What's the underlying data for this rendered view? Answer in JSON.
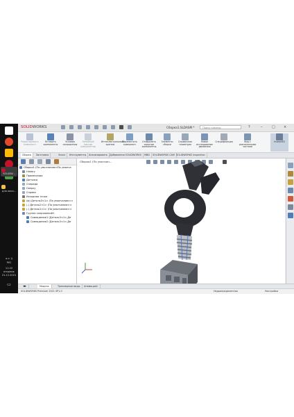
{
  "taskbar": {
    "pinned_label": "SOLIDW...",
    "folder_label": "для коси...",
    "lang": "РУС",
    "time": "11:22",
    "weekday": "вторник",
    "date": "21.12.2021"
  },
  "titlebar": {
    "brand_bold": "SOLID",
    "brand_rest": "WORKS",
    "document_title": "Сборка1.SLDASM *",
    "search_placeholder": "Поиск команд"
  },
  "ribbon": {
    "buttons": [
      {
        "label": "Редактировать компонент",
        "enabled": false
      },
      {
        "label": "Вставить компоненты",
        "enabled": true
      },
      {
        "label": "Условия сопряжения",
        "enabled": true
      },
      {
        "label": "Линейный массив компонентов",
        "enabled": false
      },
      {
        "label": "Интеллектуальный крепеж",
        "enabled": true
      },
      {
        "label": "Переместить компонент",
        "enabled": true
      },
      {
        "label": "Отобразить скрытые компоненты",
        "enabled": true
      },
      {
        "label": "Элементы сборки",
        "enabled": true
      },
      {
        "label": "Справочная геометрия",
        "enabled": true
      },
      {
        "label": "Новое исследование движения",
        "enabled": true
      },
      {
        "label": "Спецификация",
        "enabled": true
      },
      {
        "label": "Вид с разнесенными частями",
        "enabled": true
      },
      {
        "label": "Instant3D",
        "enabled": true
      }
    ]
  },
  "command_tabs": [
    "Сборка",
    "Заготовка",
    "Эскиз",
    "Инструменты",
    "Анализировать",
    "Добавления SOLIDWORKS",
    "MBD",
    "SOLIDWORKS CAM",
    "SOLIDWORKS Inspection"
  ],
  "feature_tree": {
    "items": [
      {
        "label": "Сборка1 (По умолчанию<По умолча",
        "color": "#5b7db5"
      },
      {
        "label": "History",
        "color": "#7a8a9c"
      },
      {
        "label": "Примечания",
        "color": "#9a8d3c"
      },
      {
        "label": "Датчики",
        "color": "#4e7eb8"
      },
      {
        "label": "Спереди",
        "color": "#9aa7b8"
      },
      {
        "label": "Сверху",
        "color": "#9aa7b8"
      },
      {
        "label": "Справа",
        "color": "#9aa7b8"
      },
      {
        "label": "Исходная точка",
        "color": "#777777"
      },
      {
        "label": "(ф) Деталь3<1> (По умолчанию<<",
        "color": "#c8a23a"
      },
      {
        "label": "(-) Деталь2<1> (По умолчанию<<",
        "color": "#c8a23a"
      },
      {
        "label": "(-) Деталь1<1> (По умолчанию<<",
        "color": "#c8a23a"
      },
      {
        "label": "Группа сопряжений1",
        "color": "#6c8bb0"
      },
      {
        "label": "Совпадение1 (Деталь3<1>,Де",
        "color": "#4e7eb8"
      },
      {
        "label": "Совпадение2 (Деталь3<1>,Де",
        "color": "#4e7eb8"
      }
    ]
  },
  "viewport": {
    "breadcrumb": "Сборка1 (По умолчан..."
  },
  "bottom_tabs": [
    "Модель",
    "Трехмерные виды",
    "Анимация1"
  ],
  "status": {
    "version": "SOLIDWORKS Premium 2021 SP1.0",
    "state": "Недоопределенная",
    "mode": "Настройка"
  },
  "colors": {
    "brand": "#c0122b",
    "part_dark": "#2a2c31",
    "part_metal": "#b9bec6",
    "viewport_bg": "#ffffff"
  }
}
